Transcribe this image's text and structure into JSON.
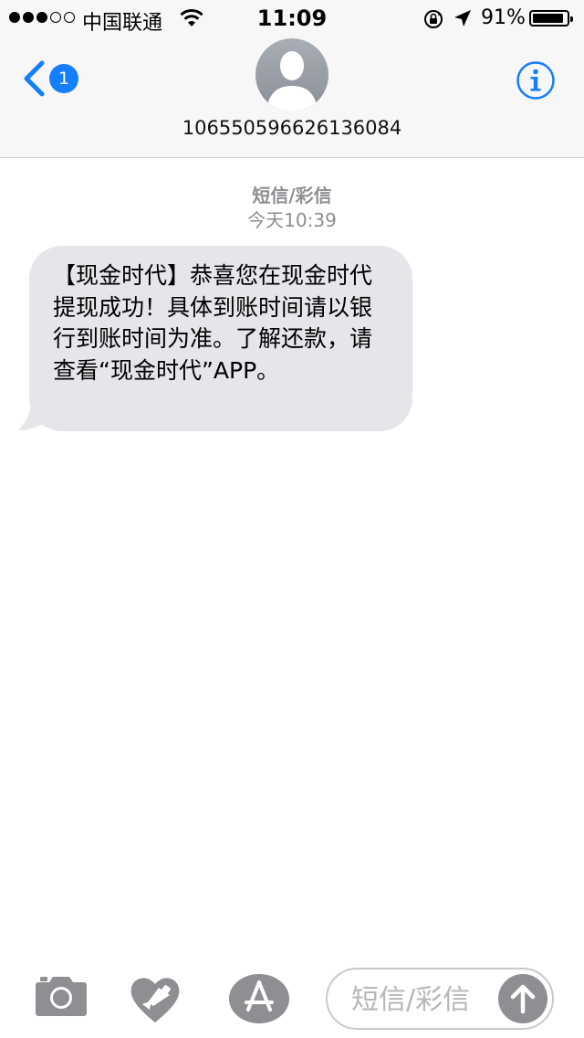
{
  "status_bar": {
    "carrier": "中国联通",
    "time": "11:09",
    "battery_percent": "91%",
    "battery_level": 0.91,
    "signal_bars_filled": 3,
    "signal_bars_total": 5
  },
  "nav": {
    "unread_count": "1",
    "contact_number": "106550596626136084",
    "accent_color": "#147efb"
  },
  "conversation": {
    "message_kind": "短信/彩信",
    "timestamp": "今天10:39",
    "messages": [
      {
        "direction": "incoming",
        "text": "【现金时代】恭喜您在现金时代提现成功！具体到账时间请以银行到账时间为准。了解还款，请查看“现金时代”APP。"
      }
    ]
  },
  "composer": {
    "placeholder": "短信/彩信"
  },
  "icons": [
    "wifi-icon",
    "orientation-lock-icon",
    "location-arrow-icon",
    "back-chevron-icon",
    "info-icon",
    "camera-icon",
    "digital-touch-heart-icon",
    "app-store-icon",
    "send-arrow-icon"
  ]
}
